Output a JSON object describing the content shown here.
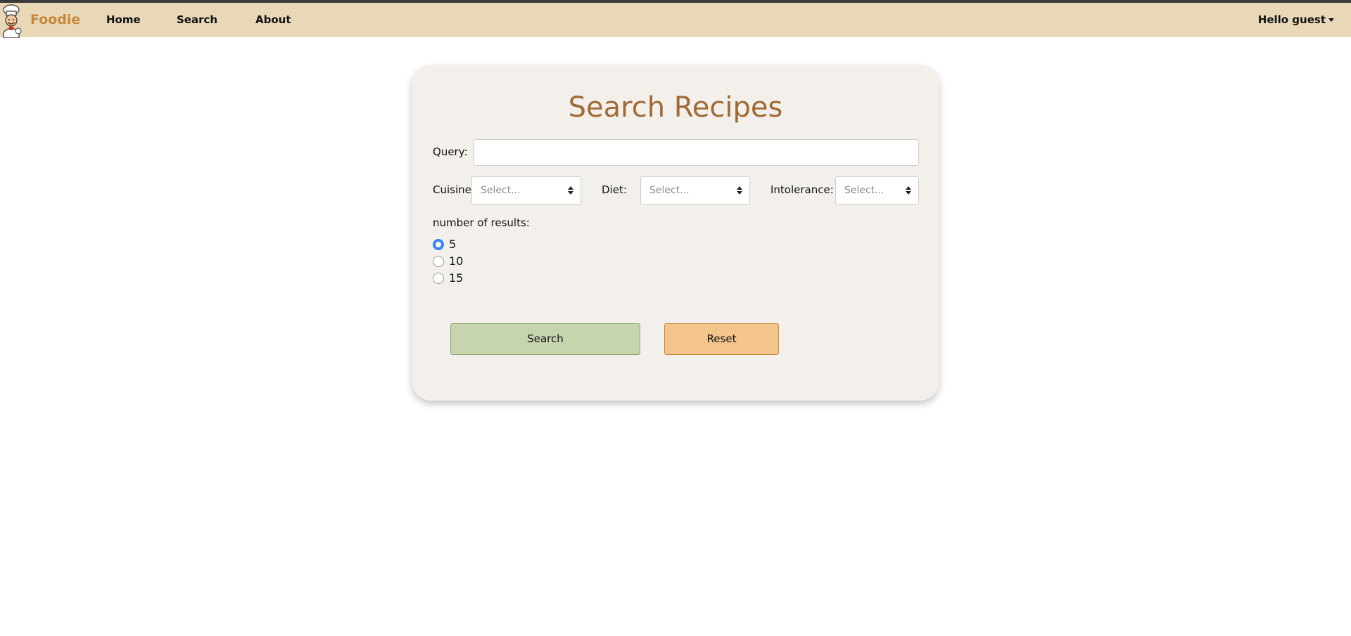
{
  "navbar": {
    "brand": "Foodie",
    "links": [
      "Home",
      "Search",
      "About"
    ],
    "user_menu": "Hello guest",
    "logo_icon": "chef-logo-icon",
    "background_color": "#e9d8b8",
    "brand_color": "#c8873a"
  },
  "search_form": {
    "title": "Search Recipes",
    "query_label": "Query:",
    "query_value": "",
    "cuisine_label": "Cuisine:",
    "cuisine_selected": "Select...",
    "diet_label": "Diet:",
    "diet_selected": "Select...",
    "intolerance_label": "Intolerance:",
    "intolerance_selected": "Select...",
    "results_label": "number of results:",
    "results_options": [
      "5",
      "10",
      "15"
    ],
    "results_selected": "5",
    "search_button": "Search",
    "reset_button": "Reset",
    "title_color": "#a06a35",
    "search_button_color": "#c6d5ae",
    "reset_button_color": "#f3c58c"
  }
}
